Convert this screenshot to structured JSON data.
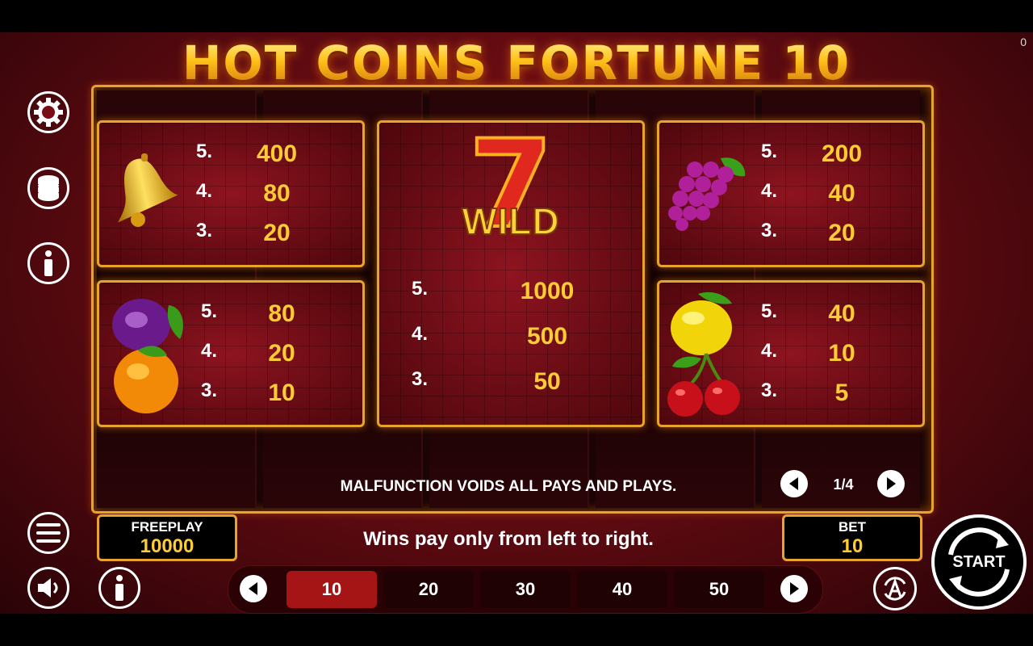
{
  "game_title": "HOT COINS FORTUNE 10",
  "corner_counter": "0",
  "paytable": {
    "bell": {
      "symbol": "bell",
      "rows": [
        {
          "count": "5.",
          "value": "400"
        },
        {
          "count": "4.",
          "value": "80"
        },
        {
          "count": "3.",
          "value": "20"
        }
      ]
    },
    "grapes": {
      "symbol": "grapes",
      "rows": [
        {
          "count": "5.",
          "value": "200"
        },
        {
          "count": "4.",
          "value": "40"
        },
        {
          "count": "3.",
          "value": "20"
        }
      ]
    },
    "plum_orange": {
      "symbol": "plum-and-orange",
      "rows": [
        {
          "count": "5.",
          "value": "80"
        },
        {
          "count": "4.",
          "value": "20"
        },
        {
          "count": "3.",
          "value": "10"
        }
      ]
    },
    "lemon_cherry": {
      "symbol": "lemon-and-cherry",
      "rows": [
        {
          "count": "5.",
          "value": "40"
        },
        {
          "count": "4.",
          "value": "10"
        },
        {
          "count": "3.",
          "value": "5"
        }
      ]
    },
    "wild": {
      "symbol": "seven",
      "label": "WILD",
      "seven": "7",
      "rows": [
        {
          "count": "5.",
          "value": "1000"
        },
        {
          "count": "4.",
          "value": "500"
        },
        {
          "count": "3.",
          "value": "50"
        }
      ]
    }
  },
  "malfunction_text": "MALFUNCTION VOIDS ALL PAYS AND PLAYS.",
  "page_indicator": "1/4",
  "freeplay": {
    "label": "FREEPLAY",
    "value": "10000"
  },
  "bet": {
    "label": "BET",
    "value": "10"
  },
  "hint_text": "Wins pay only from left to right.",
  "bet_options": [
    "10",
    "20",
    "30",
    "40",
    "50"
  ],
  "selected_bet": "10",
  "start_label": "START",
  "colors": {
    "gold": "#ffcc33",
    "frame": "#e8a42a",
    "panel": "#6a0a12",
    "selected": "#a51515"
  }
}
